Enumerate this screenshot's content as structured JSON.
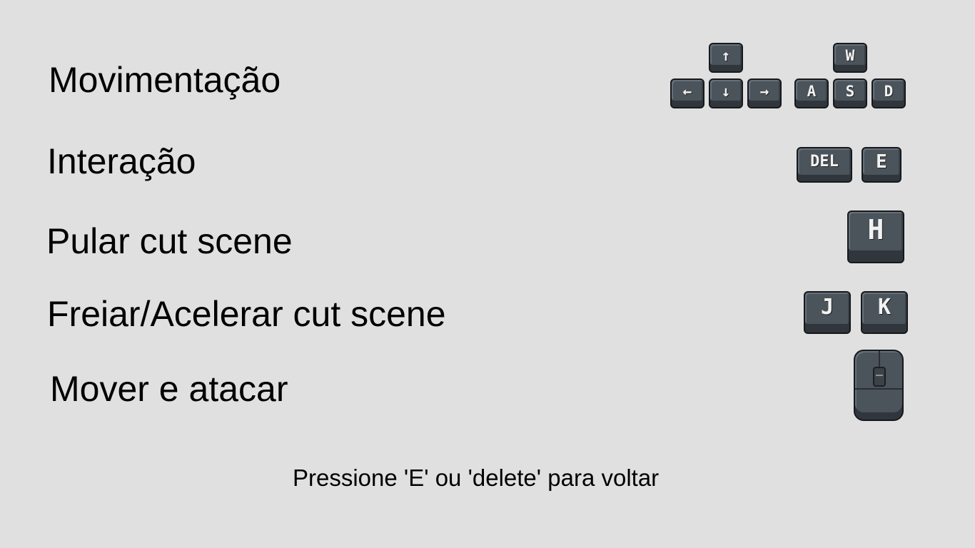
{
  "controls": [
    {
      "label": "Movimentação",
      "keys": [
        "↑",
        "←",
        "↓",
        "→",
        "W",
        "A",
        "S",
        "D"
      ]
    },
    {
      "label": "Interação",
      "keys": [
        "DEL",
        "E"
      ]
    },
    {
      "label": "Pular cut scene",
      "keys": [
        "H"
      ]
    },
    {
      "label": "Freiar/Acelerar cut scene",
      "keys": [
        "J",
        "K"
      ]
    },
    {
      "label": "Mover e atacar",
      "device": "mouse-icon"
    }
  ],
  "footer": "Pressione 'E' ou 'delete' para voltar",
  "colors": {
    "background": "#e0e0e0",
    "key_face": "#4b535b",
    "key_outline": "#16191c",
    "key_text": "#f2f2f2"
  }
}
